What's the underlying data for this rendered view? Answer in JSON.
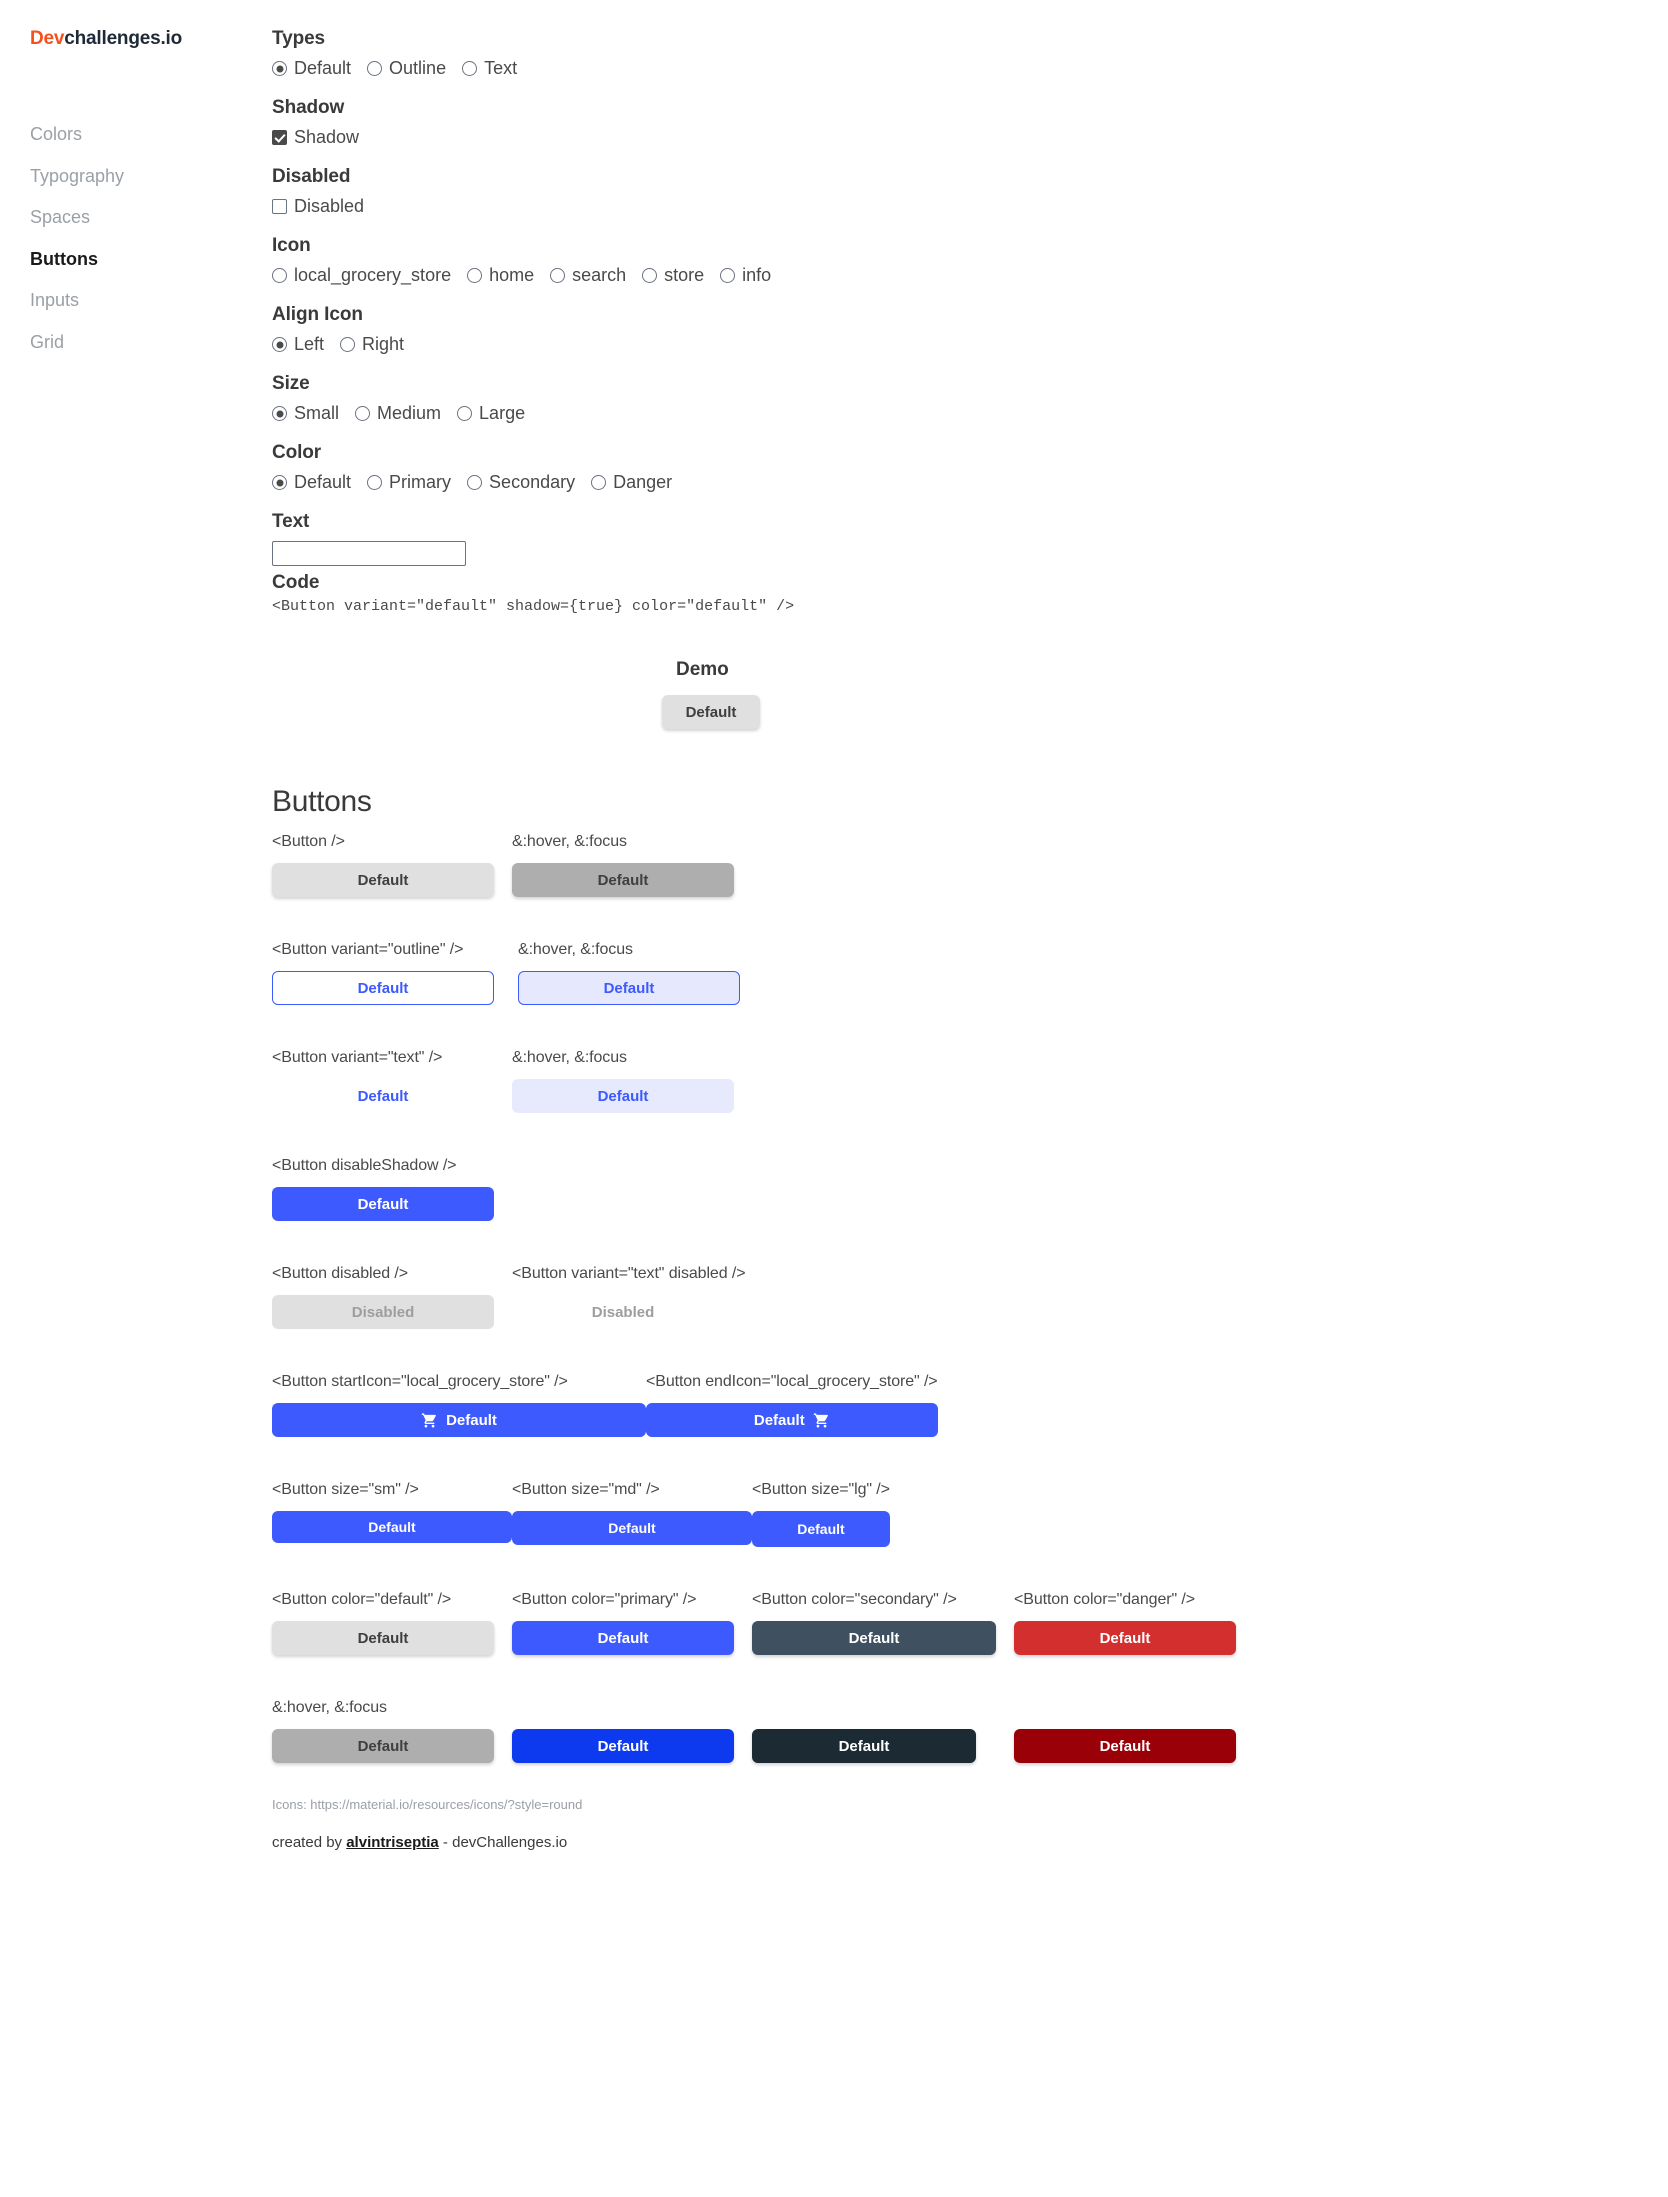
{
  "brand": {
    "prefix": "Dev",
    "suffix": "challenges.io"
  },
  "sidebar": {
    "items": [
      {
        "label": "Colors",
        "active": false
      },
      {
        "label": "Typography",
        "active": false
      },
      {
        "label": "Spaces",
        "active": false
      },
      {
        "label": "Buttons",
        "active": true
      },
      {
        "label": "Inputs",
        "active": false
      },
      {
        "label": "Grid",
        "active": false
      }
    ]
  },
  "controls": {
    "types": {
      "title": "Types",
      "options": [
        "Default",
        "Outline",
        "Text"
      ],
      "selected": "Default"
    },
    "shadow": {
      "title": "Shadow",
      "label": "Shadow",
      "checked": true
    },
    "disabled": {
      "title": "Disabled",
      "label": "Disabled",
      "checked": false
    },
    "icon": {
      "title": "Icon",
      "options": [
        "local_grocery_store",
        "home",
        "search",
        "store",
        "info"
      ],
      "selected": ""
    },
    "align_icon": {
      "title": "Align Icon",
      "options": [
        "Left",
        "Right"
      ],
      "selected": "Left"
    },
    "size": {
      "title": "Size",
      "options": [
        "Small",
        "Medium",
        "Large"
      ],
      "selected": "Small"
    },
    "color": {
      "title": "Color",
      "options": [
        "Default",
        "Primary",
        "Secondary",
        "Danger"
      ],
      "selected": "Default"
    },
    "text": {
      "title": "Text",
      "value": "",
      "placeholder": ""
    },
    "code": {
      "title": "Code",
      "value": "<Button variant=\"default\" shadow={true} color=\"default\" />"
    }
  },
  "demo": {
    "title": "Demo",
    "button_label": "Default"
  },
  "showcase": {
    "heading": "Buttons",
    "hover_label": "&:hover, &:focus",
    "rows": [
      {
        "cells": [
          {
            "label": "<Button />",
            "button": "Default"
          },
          {
            "label": "&:hover, &:focus",
            "button": "Default"
          }
        ]
      },
      {
        "cells": [
          {
            "label": "<Button variant=\"outline\" />",
            "button": "Default"
          },
          {
            "label": "&:hover, &:focus",
            "button": "Default"
          }
        ]
      },
      {
        "cells": [
          {
            "label": "<Button variant=\"text\" />",
            "button": "Default"
          },
          {
            "label": "&:hover, &:focus",
            "button": "Default"
          }
        ]
      },
      {
        "cells": [
          {
            "label": "<Button disableShadow />",
            "button": "Default"
          }
        ]
      },
      {
        "cells": [
          {
            "label": "<Button disabled />",
            "button": "Disabled"
          },
          {
            "label": "<Button variant=\"text\" disabled />",
            "button": "Disabled"
          }
        ]
      },
      {
        "cells": [
          {
            "label": "<Button startIcon=\"local_grocery_store\" />",
            "button": "Default"
          },
          {
            "label": "<Button endIcon=\"local_grocery_store\" />",
            "button": "Default"
          }
        ]
      },
      {
        "cells": [
          {
            "label": "<Button size=\"sm\" />",
            "button": "Default"
          },
          {
            "label": "<Button size=\"md\" />",
            "button": "Default"
          },
          {
            "label": "<Button size=\"lg\" />",
            "button": "Default"
          }
        ]
      },
      {
        "cells": [
          {
            "label": "<Button color=\"default\" />",
            "button": "Default"
          },
          {
            "label": "<Button color=\"primary\" />",
            "button": "Default"
          },
          {
            "label": "<Button color=\"secondary\" />",
            "button": "Default"
          },
          {
            "label": "<Button color=\"danger\" />",
            "button": "Default"
          }
        ]
      },
      {
        "cells": [
          {
            "label": "&:hover, &:focus",
            "button": "Default"
          },
          {
            "label": "",
            "button": "Default"
          },
          {
            "label": "",
            "button": "Default"
          },
          {
            "label": "",
            "button": "Default"
          }
        ]
      }
    ]
  },
  "footer": {
    "icons_note": "Icons: https://material.io/resources/icons/?style=round",
    "created_prefix": "created by ",
    "author": "alvintriseptia",
    "created_suffix": " - devChallenges.io"
  },
  "colors": {
    "brand_accent": "#F4511E",
    "brand_dark": "#1F2937",
    "primary": "#3D5AFE",
    "secondary": "#3F5060",
    "danger": "#D32F2F",
    "default_btn": "#E0E0E0"
  }
}
